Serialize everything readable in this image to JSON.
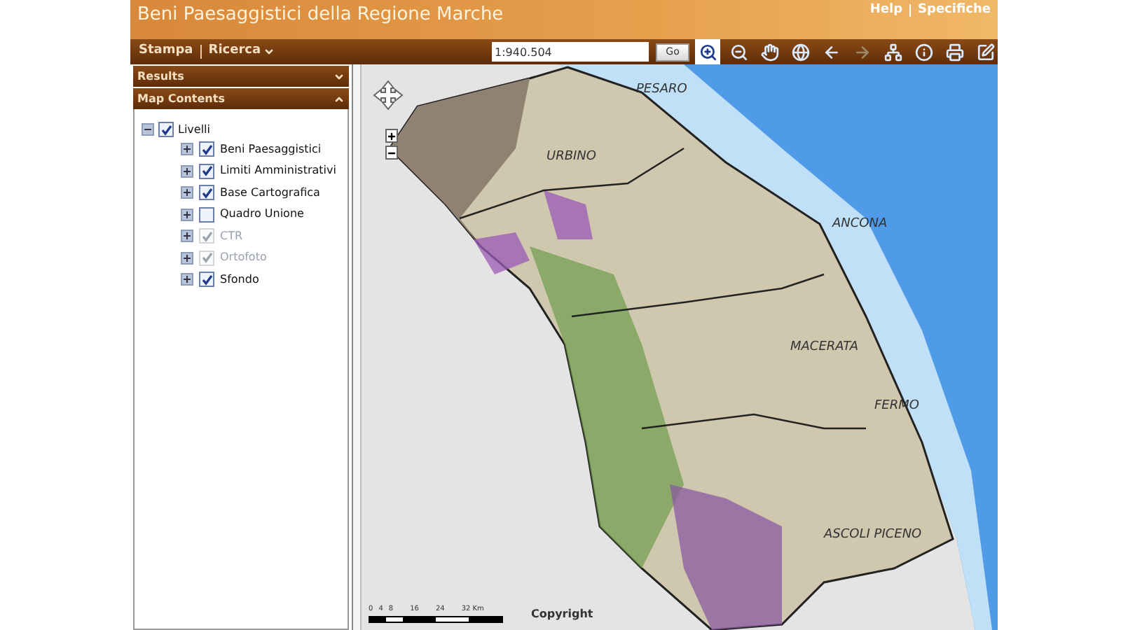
{
  "header": {
    "title": "Beni Paesaggistici della Regione Marche",
    "links": [
      "Help",
      "Specifiche"
    ]
  },
  "toolbar": {
    "menus": [
      {
        "label": "Stampa",
        "dropdown": false
      },
      {
        "label": "Ricerca",
        "dropdown": true
      }
    ],
    "scale": {
      "value": "1:940.504"
    },
    "go": "Go",
    "tools": [
      {
        "selected": true,
        "disabled": false
      },
      {
        "selected": false,
        "disabled": false
      },
      {
        "selected": false,
        "disabled": false
      },
      {
        "selected": false,
        "disabled": false
      },
      {
        "selected": false,
        "disabled": false
      },
      {
        "selected": false,
        "disabled": true
      },
      {
        "selected": false,
        "disabled": false
      },
      {
        "selected": false,
        "disabled": false
      },
      {
        "selected": false,
        "disabled": false
      },
      {
        "selected": false,
        "disabled": false
      }
    ]
  },
  "panels": [
    {
      "title": "Results",
      "expanded": false
    },
    {
      "title": "Map Contents",
      "expanded": true
    }
  ],
  "tree": {
    "label": "Livelli",
    "checked": true,
    "expanded": true,
    "children": [
      {
        "label": "Beni Paesaggistici",
        "checked": true,
        "disabled": false
      },
      {
        "label": "Limiti Amministrativi",
        "checked": true,
        "disabled": false
      },
      {
        "label": "Base Cartografica",
        "checked": true,
        "disabled": false
      },
      {
        "label": "Quadro Unione",
        "checked": false,
        "disabled": false
      },
      {
        "label": "CTR",
        "checked": true,
        "disabled": true
      },
      {
        "label": "Ortofoto",
        "checked": true,
        "disabled": true
      },
      {
        "label": "Sfondo",
        "checked": true,
        "disabled": false
      }
    ]
  },
  "map": {
    "places": [
      "PESARO",
      "URBINO",
      "ANCONA",
      "MACERATA",
      "FERMO",
      "ASCOLI PICENO"
    ],
    "scale_bar": [
      "0",
      "4",
      "8",
      "16",
      "24",
      "32 Km"
    ],
    "copyright": "Copyright"
  }
}
